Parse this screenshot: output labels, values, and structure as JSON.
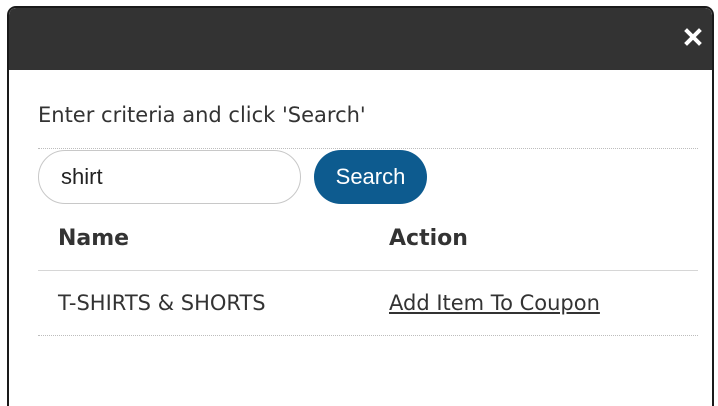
{
  "dialog": {
    "close_icon": "close-icon"
  },
  "search": {
    "instructions": "Enter criteria and click 'Search'",
    "input_value": "shirt",
    "button_label": "Search"
  },
  "table": {
    "columns": [
      "Name",
      "Action"
    ],
    "rows": [
      {
        "name": "T-SHIRTS & SHORTS",
        "action": "Add Item To Coupon"
      }
    ]
  },
  "colors": {
    "titlebar": "#333333",
    "search_button": "#0d5b8f"
  }
}
